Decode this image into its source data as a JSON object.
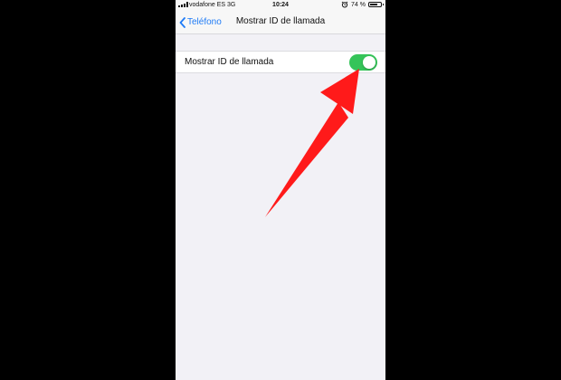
{
  "status_bar": {
    "carrier": "vodafone ES 3G",
    "time": "10:24",
    "battery_percent": "74 %",
    "battery_level": 0.74
  },
  "nav": {
    "back_label": "Teléfono",
    "title": "Mostrar ID de llamada"
  },
  "setting": {
    "label": "Mostrar ID de llamada",
    "enabled": true
  },
  "colors": {
    "accent": "#1f7bf6",
    "toggle_on": "#35c459",
    "arrow": "#ff1a1a",
    "background": "#f2f1f6"
  },
  "icons": [
    "signal-icon",
    "alarm-icon",
    "battery-icon",
    "chevron-left-icon",
    "annotation-arrow"
  ]
}
